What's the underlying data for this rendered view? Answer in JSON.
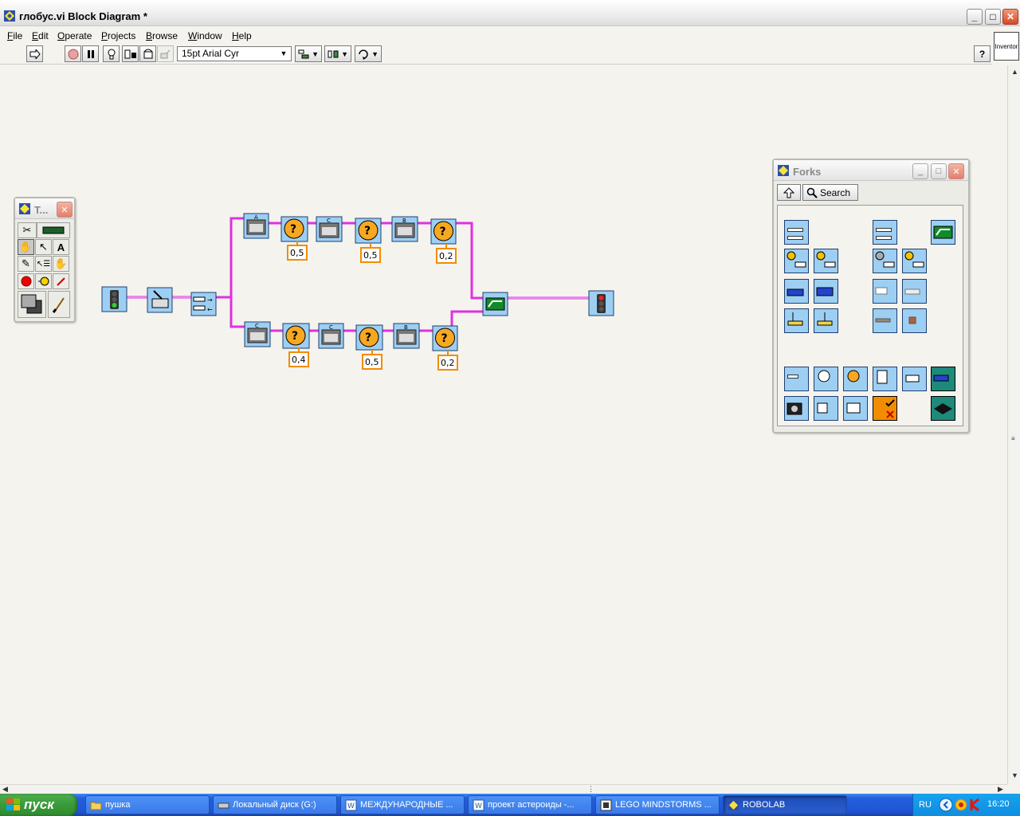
{
  "window": {
    "title": "глобус.vi Block Diagram *",
    "minimize": "_",
    "maximize": "□",
    "close": "✕"
  },
  "menu": [
    "File",
    "Edit",
    "Operate",
    "Projects",
    "Browse",
    "Window",
    "Help"
  ],
  "toolbar": {
    "font_value": "15pt Arial Cyr",
    "inventor_label": "Inventor"
  },
  "tools_palette": {
    "title": "T..."
  },
  "forks_palette": {
    "title": "Forks",
    "search_label": "Search"
  },
  "diagram": {
    "top_motor_labels": [
      "A",
      "C",
      "B"
    ],
    "bottom_motor_labels": [
      "C",
      "C",
      "B"
    ],
    "top_wait_values": [
      "0,5",
      "0,5",
      "0,2"
    ],
    "bottom_wait_values": [
      "0,4",
      "0,5",
      "0,2"
    ]
  },
  "taskbar": {
    "start_label": "пуск",
    "tasks": [
      {
        "label": "пушка",
        "icon": "folder-icon"
      },
      {
        "label": "Локальный диск (G:)",
        "icon": "drive-icon"
      },
      {
        "label": "МЕЖДУНАРОДНЫЕ ...",
        "icon": "word-icon"
      },
      {
        "label": "проект астероиды -...",
        "icon": "word-icon"
      },
      {
        "label": "LEGO MINDSTORMS ...",
        "icon": "app-icon"
      },
      {
        "label": "ROBOLAB",
        "icon": "robolab-icon"
      }
    ],
    "language": "RU",
    "clock": "16:20"
  }
}
